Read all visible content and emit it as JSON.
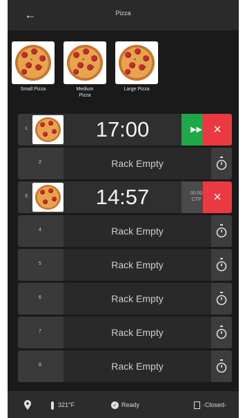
{
  "header": {
    "title": "Pizza",
    "back_icon": "back-arrow-icon"
  },
  "products": [
    {
      "label": "Small Pizza"
    },
    {
      "label": "Medium Pizza"
    },
    {
      "label": "Large Pizza"
    }
  ],
  "racks": [
    {
      "number": "1",
      "state": "cooking",
      "timer": "17:00"
    },
    {
      "number": "2",
      "state": "empty",
      "label": "Rack Empty"
    },
    {
      "number": "3",
      "state": "holding",
      "timer": "14:57",
      "hold_time": "00:00",
      "hold_label": "CTP"
    },
    {
      "number": "4",
      "state": "empty",
      "label": "Rack Empty"
    },
    {
      "number": "5",
      "state": "empty",
      "label": "Rack Empty"
    },
    {
      "number": "6",
      "state": "empty",
      "label": "Rack Empty"
    },
    {
      "number": "7",
      "state": "empty",
      "label": "Rack Empty"
    },
    {
      "number": "8",
      "state": "empty",
      "label": "Rack Empty"
    }
  ],
  "status": {
    "temperature": "321°F",
    "ready": "Ready",
    "door": "-Closed-"
  },
  "colors": {
    "go": "#1ea84a",
    "cancel": "#ea3940",
    "background": "#1a1a1a"
  }
}
